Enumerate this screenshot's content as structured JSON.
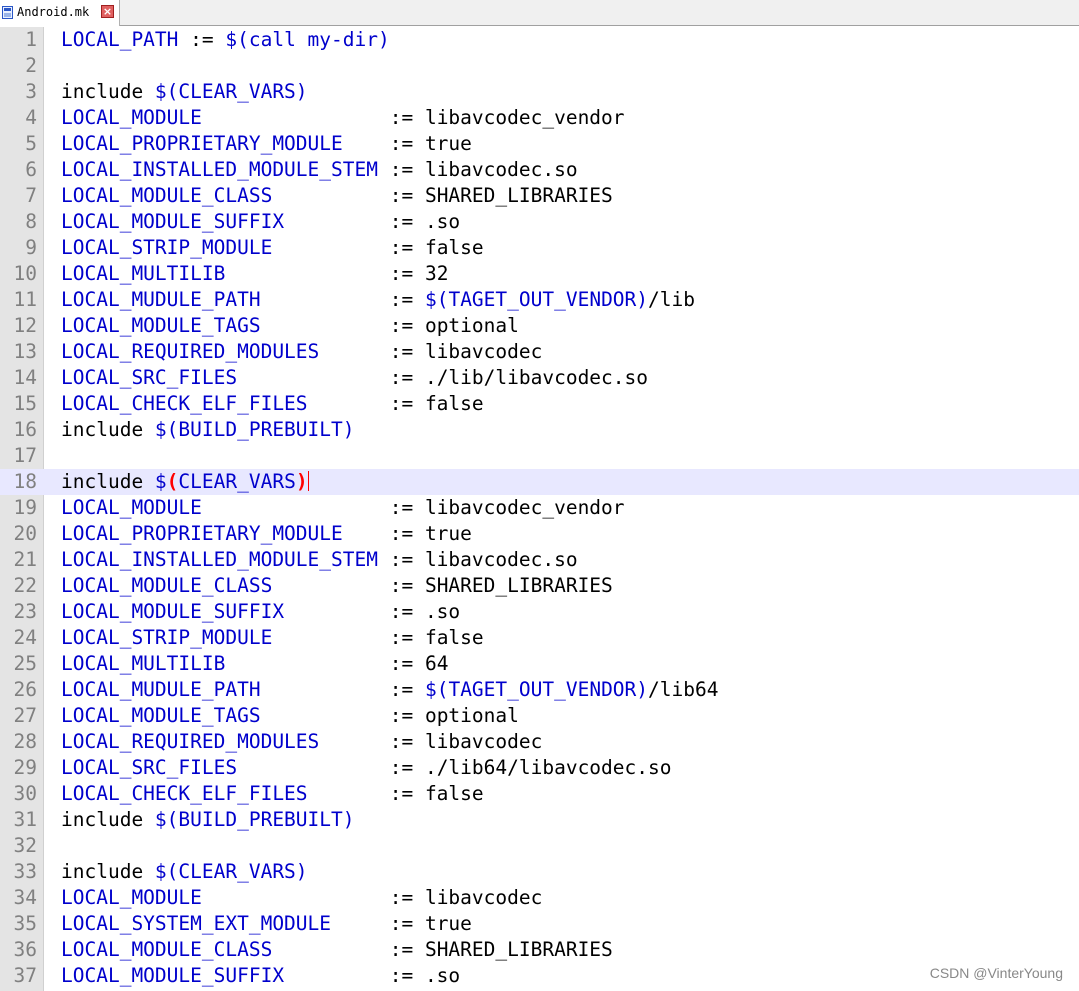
{
  "tab": {
    "label": "Android.mk",
    "close_glyph": "×",
    "icon": "file-icon",
    "close_icon": "close-icon"
  },
  "watermark": "CSDN @VinterYoung",
  "colors": {
    "variable": "#0000cc",
    "plain": "#000000",
    "bracket_highlight": "#ff0000",
    "active_line": "#e8e8ff",
    "line_number": "#808080"
  },
  "active_line": 18,
  "lines": [
    {
      "n": "1",
      "t": [
        {
          "s": "LOCAL_PATH",
          "c": "v"
        },
        {
          "s": " := "
        },
        {
          "s": "$(call my-dir)",
          "c": "v"
        }
      ]
    },
    {
      "n": "2",
      "t": []
    },
    {
      "n": "3",
      "t": [
        {
          "s": "include "
        },
        {
          "s": "$(CLEAR_VARS)",
          "c": "v"
        }
      ]
    },
    {
      "n": "4",
      "t": [
        {
          "s": "LOCAL_MODULE",
          "c": "v"
        },
        {
          "s": "                := libavcodec_vendor"
        }
      ]
    },
    {
      "n": "5",
      "t": [
        {
          "s": "LOCAL_PROPRIETARY_MODULE",
          "c": "v"
        },
        {
          "s": "    := true"
        }
      ]
    },
    {
      "n": "6",
      "t": [
        {
          "s": "LOCAL_INSTALLED_MODULE_STEM",
          "c": "v"
        },
        {
          "s": " := libavcodec.so"
        }
      ]
    },
    {
      "n": "7",
      "t": [
        {
          "s": "LOCAL_MODULE_CLASS",
          "c": "v"
        },
        {
          "s": "          := SHARED_LIBRARIES"
        }
      ]
    },
    {
      "n": "8",
      "t": [
        {
          "s": "LOCAL_MODULE_SUFFIX",
          "c": "v"
        },
        {
          "s": "         := .so"
        }
      ]
    },
    {
      "n": "9",
      "t": [
        {
          "s": "LOCAL_STRIP_MODULE",
          "c": "v"
        },
        {
          "s": "          := false"
        }
      ]
    },
    {
      "n": "10",
      "t": [
        {
          "s": "LOCAL_MULTILIB",
          "c": "v"
        },
        {
          "s": "              := 32"
        }
      ]
    },
    {
      "n": "11",
      "t": [
        {
          "s": "LOCAL_MUDULE_PATH",
          "c": "v"
        },
        {
          "s": "           := "
        },
        {
          "s": "$(TAGET_OUT_VENDOR)",
          "c": "v"
        },
        {
          "s": "/lib"
        }
      ]
    },
    {
      "n": "12",
      "t": [
        {
          "s": "LOCAL_MODULE_TAGS",
          "c": "v"
        },
        {
          "s": "           := optional"
        }
      ]
    },
    {
      "n": "13",
      "t": [
        {
          "s": "LOCAL_REQUIRED_MODULES",
          "c": "v"
        },
        {
          "s": "      := libavcodec"
        }
      ]
    },
    {
      "n": "14",
      "t": [
        {
          "s": "LOCAL_SRC_FILES",
          "c": "v"
        },
        {
          "s": "             := ./lib/libavcodec.so"
        }
      ]
    },
    {
      "n": "15",
      "t": [
        {
          "s": "LOCAL_CHECK_ELF_FILES",
          "c": "v"
        },
        {
          "s": "       := false"
        }
      ]
    },
    {
      "n": "16",
      "t": [
        {
          "s": "include "
        },
        {
          "s": "$(BUILD_PREBUILT)",
          "c": "v"
        }
      ]
    },
    {
      "n": "17",
      "t": []
    },
    {
      "n": "18",
      "t": [
        {
          "s": "include "
        },
        {
          "s": "$",
          "c": "v"
        },
        {
          "s": "(",
          "c": "br"
        },
        {
          "s": "CLEAR_VARS",
          "c": "v"
        },
        {
          "s": ")",
          "c": "br"
        },
        {
          "s": "",
          "c": "caret"
        }
      ]
    },
    {
      "n": "19",
      "t": [
        {
          "s": "LOCAL_MODULE",
          "c": "v"
        },
        {
          "s": "                := libavcodec_vendor"
        }
      ]
    },
    {
      "n": "20",
      "t": [
        {
          "s": "LOCAL_PROPRIETARY_MODULE",
          "c": "v"
        },
        {
          "s": "    := true"
        }
      ]
    },
    {
      "n": "21",
      "t": [
        {
          "s": "LOCAL_INSTALLED_MODULE_STEM",
          "c": "v"
        },
        {
          "s": " := libavcodec.so"
        }
      ]
    },
    {
      "n": "22",
      "t": [
        {
          "s": "LOCAL_MODULE_CLASS",
          "c": "v"
        },
        {
          "s": "          := SHARED_LIBRARIES"
        }
      ]
    },
    {
      "n": "23",
      "t": [
        {
          "s": "LOCAL_MODULE_SUFFIX",
          "c": "v"
        },
        {
          "s": "         := .so"
        }
      ]
    },
    {
      "n": "24",
      "t": [
        {
          "s": "LOCAL_STRIP_MODULE",
          "c": "v"
        },
        {
          "s": "          := false"
        }
      ]
    },
    {
      "n": "25",
      "t": [
        {
          "s": "LOCAL_MULTILIB",
          "c": "v"
        },
        {
          "s": "              := 64"
        }
      ]
    },
    {
      "n": "26",
      "t": [
        {
          "s": "LOCAL_MUDULE_PATH",
          "c": "v"
        },
        {
          "s": "           := "
        },
        {
          "s": "$(TAGET_OUT_VENDOR)",
          "c": "v"
        },
        {
          "s": "/lib64"
        }
      ]
    },
    {
      "n": "27",
      "t": [
        {
          "s": "LOCAL_MODULE_TAGS",
          "c": "v"
        },
        {
          "s": "           := optional"
        }
      ]
    },
    {
      "n": "28",
      "t": [
        {
          "s": "LOCAL_REQUIRED_MODULES",
          "c": "v"
        },
        {
          "s": "      := libavcodec"
        }
      ]
    },
    {
      "n": "29",
      "t": [
        {
          "s": "LOCAL_SRC_FILES",
          "c": "v"
        },
        {
          "s": "             := ./lib64/libavcodec.so"
        }
      ]
    },
    {
      "n": "30",
      "t": [
        {
          "s": "LOCAL_CHECK_ELF_FILES",
          "c": "v"
        },
        {
          "s": "       := false"
        }
      ]
    },
    {
      "n": "31",
      "t": [
        {
          "s": "include "
        },
        {
          "s": "$(BUILD_PREBUILT)",
          "c": "v"
        }
      ]
    },
    {
      "n": "32",
      "t": []
    },
    {
      "n": "33",
      "t": [
        {
          "s": "include "
        },
        {
          "s": "$(CLEAR_VARS)",
          "c": "v"
        }
      ]
    },
    {
      "n": "34",
      "t": [
        {
          "s": "LOCAL_MODULE",
          "c": "v"
        },
        {
          "s": "                := libavcodec"
        }
      ]
    },
    {
      "n": "35",
      "t": [
        {
          "s": "LOCAL_SYSTEM_EXT_MODULE",
          "c": "v"
        },
        {
          "s": "     := true"
        }
      ]
    },
    {
      "n": "36",
      "t": [
        {
          "s": "LOCAL_MODULE_CLASS",
          "c": "v"
        },
        {
          "s": "          := SHARED_LIBRARIES"
        }
      ]
    },
    {
      "n": "37",
      "t": [
        {
          "s": "LOCAL_MODULE_SUFFIX",
          "c": "v"
        },
        {
          "s": "         := .so"
        }
      ]
    }
  ]
}
